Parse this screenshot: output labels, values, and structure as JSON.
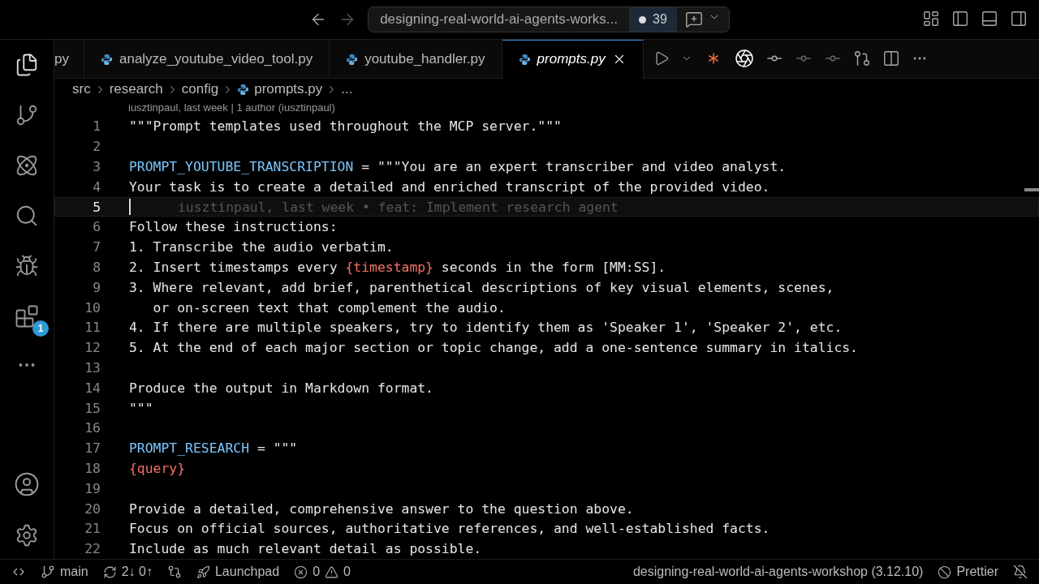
{
  "title_bar": {
    "command_center": "designing-real-world-ai-agents-works...",
    "changes_count": "39"
  },
  "activity_bar": {
    "extensions_badge": "1"
  },
  "tabs": [
    {
      "label": "py",
      "selected": false,
      "python": false
    },
    {
      "label": "analyze_youtube_video_tool.py",
      "selected": false,
      "python": true
    },
    {
      "label": "youtube_handler.py",
      "selected": false,
      "python": true
    },
    {
      "label": "prompts.py",
      "selected": true,
      "python": true
    }
  ],
  "breadcrumb": [
    {
      "label": "src",
      "python": false
    },
    {
      "label": "research",
      "python": false
    },
    {
      "label": "config",
      "python": false
    },
    {
      "label": "prompts.py",
      "python": true
    },
    {
      "label": "...",
      "python": false
    }
  ],
  "blame_header": "iusztinpaul, last week | 1 author (iusztinpaul)",
  "lines": [
    {
      "number": "1",
      "current": false,
      "segments": [
        {
          "kind": "string",
          "text": "\"\"\"Prompt templates used throughout the MCP server.\"\"\""
        }
      ]
    },
    {
      "number": "2",
      "current": false
    },
    {
      "number": "3",
      "current": false,
      "segments": [
        {
          "kind": "name",
          "text": "PROMPT_YOUTUBE_TRANSCRIPTION"
        },
        {
          "kind": "string",
          "text": " = \"\"\"You are an expert transcriber and video analyst."
        }
      ]
    },
    {
      "number": "4",
      "current": false,
      "segments": [
        {
          "kind": "string",
          "text": "Your task is to create a detailed and enriched transcript of the provided video."
        }
      ]
    },
    {
      "number": "5",
      "current": true,
      "blame": "iusztinpaul, last week • feat: Implement research agent"
    },
    {
      "number": "6",
      "current": false,
      "segments": [
        {
          "kind": "string",
          "text": "Follow these instructions:"
        }
      ]
    },
    {
      "number": "7",
      "current": false,
      "segments": [
        {
          "kind": "string",
          "text": "1. Transcribe the audio verbatim."
        }
      ]
    },
    {
      "number": "8",
      "current": false,
      "segments": [
        {
          "kind": "string",
          "text": "2. Insert timestamps every "
        },
        {
          "kind": "placeholder",
          "text": "{timestamp}"
        },
        {
          "kind": "string",
          "text": " seconds in the form [MM:SS]."
        }
      ]
    },
    {
      "number": "9",
      "current": false,
      "segments": [
        {
          "kind": "string",
          "text": "3. Where relevant, add brief, parenthetical descriptions of key visual elements, scenes,"
        }
      ]
    },
    {
      "number": "10",
      "current": false,
      "segments": [
        {
          "kind": "string",
          "text": "   or on-screen text that complement the audio."
        }
      ]
    },
    {
      "number": "11",
      "current": false,
      "segments": [
        {
          "kind": "string",
          "text": "4. If there are multiple speakers, try to identify them as 'Speaker 1', 'Speaker 2', etc."
        }
      ]
    },
    {
      "number": "12",
      "current": false,
      "segments": [
        {
          "kind": "string",
          "text": "5. At the end of each major section or topic change, add a one-sentence summary in italics."
        }
      ]
    },
    {
      "number": "13",
      "current": false
    },
    {
      "number": "14",
      "current": false,
      "segments": [
        {
          "kind": "string",
          "text": "Produce the output in Markdown format."
        }
      ]
    },
    {
      "number": "15",
      "current": false,
      "segments": [
        {
          "kind": "string",
          "text": "\"\"\""
        }
      ]
    },
    {
      "number": "16",
      "current": false
    },
    {
      "number": "17",
      "current": false,
      "segments": [
        {
          "kind": "name",
          "text": "PROMPT_RESEARCH"
        },
        {
          "kind": "string",
          "text": " = \"\"\""
        }
      ]
    },
    {
      "number": "18",
      "current": false,
      "segments": [
        {
          "kind": "placeholder",
          "text": "{query}"
        }
      ]
    },
    {
      "number": "19",
      "current": false
    },
    {
      "number": "20",
      "current": false,
      "segments": [
        {
          "kind": "string",
          "text": "Provide a detailed, comprehensive answer to the question above."
        }
      ]
    },
    {
      "number": "21",
      "current": false,
      "segments": [
        {
          "kind": "string",
          "text": "Focus on official sources, authoritative references, and well-established facts."
        }
      ]
    },
    {
      "number": "22",
      "current": false,
      "segments": [
        {
          "kind": "string",
          "text": "Include as much relevant detail as possible."
        }
      ]
    }
  ],
  "status_bar": {
    "branch": "main",
    "sync": "2↓ 0↑",
    "launchpad": "Launchpad",
    "errors": "0",
    "warnings": "0",
    "interpreter": "designing-real-world-ai-agents-workshop (3.12.10)",
    "formatter": "Prettier"
  }
}
